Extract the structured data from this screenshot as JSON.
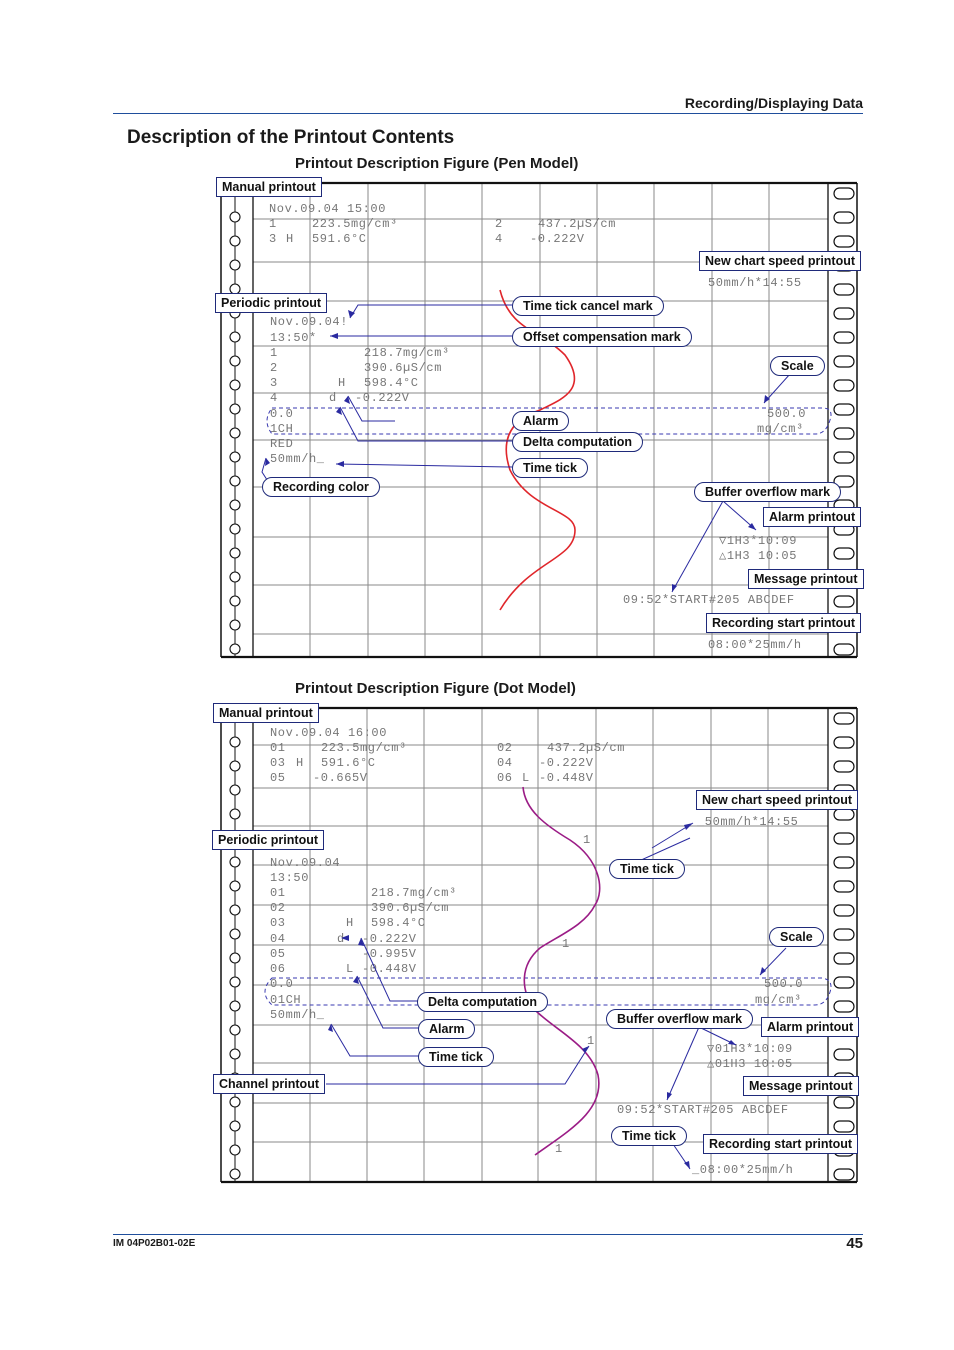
{
  "header": {
    "section": "Recording/Displaying Data",
    "title": "Description of the Printout Contents"
  },
  "colors": {
    "rule": "#1f4e9c",
    "label_border": "#1f2a7a",
    "arrow": "#2a2aa0",
    "pen_trace": "#e0262b",
    "dot_trace": "#9b1c86",
    "grid": "#8a8a8a",
    "print_text": "#777777"
  },
  "pen_figure": {
    "title": "Printout Description Figure (Pen Model)",
    "manual_printout": {
      "datetime": "Nov.09.04 15:00",
      "rows": [
        [
          "1",
          "",
          "223.5mg/cm³",
          "2",
          "",
          "437.2µS/cm"
        ],
        [
          "3",
          "H",
          "591.6°C",
          "4",
          "",
          "-0.222V"
        ]
      ]
    },
    "new_chart_speed": "50mm/h*14:55",
    "periodic_printout": {
      "date": "Nov.09.04!",
      "time": "13:50*",
      "rows": [
        {
          "ch": "1",
          "flag": "",
          "value": "218.7mg/cm³"
        },
        {
          "ch": "2",
          "flag": "",
          "value": "390.6µS/cm"
        },
        {
          "ch": "3",
          "flag": "H",
          "value": "598.4°C"
        },
        {
          "ch": "4",
          "flag": "d",
          "value": "-0.222V"
        }
      ],
      "scale_left": "0.0",
      "channel": "1CH",
      "color": "RED",
      "speed": "50mm/h_"
    },
    "scale_right_value": "500.0",
    "scale_right_unit": "mg/cm³",
    "alarm_lines": [
      "▽1H3*10:09",
      "△1H3 10:05"
    ],
    "message_line": "09:52*START#205 ABCDEF",
    "recording_start": "08:00*25mm/h",
    "labels": {
      "manual_printout": "Manual printout",
      "periodic_printout": "Periodic printout",
      "new_chart_speed_printout": "New chart speed printout",
      "time_tick_cancel_mark": "Time tick cancel mark",
      "offset_compensation_mark": "Offset compensation mark",
      "scale": "Scale",
      "alarm": "Alarm",
      "delta_computation": "Delta computation",
      "time_tick": "Time tick",
      "recording_color": "Recording color",
      "buffer_overflow_mark": "Buffer overflow mark",
      "alarm_printout": "Alarm printout",
      "message_printout": "Message printout",
      "recording_start_printout": "Recording start printout"
    }
  },
  "dot_figure": {
    "title": "Printout Description Figure (Dot Model)",
    "manual_printout": {
      "datetime": "Nov.09.04 16:00",
      "rows": [
        [
          "01",
          "",
          "223.5mg/cm³",
          "02",
          "",
          "437.2µS/cm"
        ],
        [
          "03",
          "H",
          "591.6°C",
          "04",
          "",
          "-0.222V"
        ],
        [
          "05",
          "",
          "-0.665V",
          "06",
          "L",
          "-0.448V"
        ]
      ]
    },
    "new_chart_speed": "_50mm/h*14:55",
    "periodic_printout": {
      "date": "Nov.09.04",
      "time": "13:50",
      "rows": [
        {
          "ch": "01",
          "flag": "",
          "value": "218.7mg/cm³"
        },
        {
          "ch": "02",
          "flag": "",
          "value": "390.6µS/cm"
        },
        {
          "ch": "03",
          "flag": "H",
          "value": "598.4°C"
        },
        {
          "ch": "04",
          "flag": "d",
          "value": "-0.222V"
        },
        {
          "ch": "05",
          "flag": "",
          "value": "-0.995V"
        },
        {
          "ch": "06",
          "flag": "L",
          "value": "-0.448V"
        }
      ],
      "scale_left": "0.0",
      "channel": "01CH",
      "speed": "50mm/h_"
    },
    "channel_marks": [
      "1",
      "1",
      "1",
      "1"
    ],
    "scale_right_value": "500.0",
    "scale_right_unit": "mg/cm³",
    "alarm_lines": [
      "▽01H3*10:09",
      "△01H3 10:05"
    ],
    "message_line": "09:52*START#205 ABCDEF",
    "recording_start": "_08:00*25mm/h",
    "labels": {
      "manual_printout": "Manual printout",
      "periodic_printout": "Periodic printout",
      "new_chart_speed_printout": "New chart speed printout",
      "time_tick_top": "Time tick",
      "scale": "Scale",
      "delta_computation": "Delta computation",
      "buffer_overflow_mark": "Buffer overflow mark",
      "alarm_printout": "Alarm printout",
      "alarm": "Alarm",
      "time_tick_mid": "Time tick",
      "channel_printout": "Channel printout",
      "message_printout": "Message printout",
      "time_tick_bottom": "Time tick",
      "recording_start_printout": "Recording start printout"
    }
  },
  "footer": {
    "doc_id": "IM 04P02B01-02E",
    "page": "45"
  }
}
